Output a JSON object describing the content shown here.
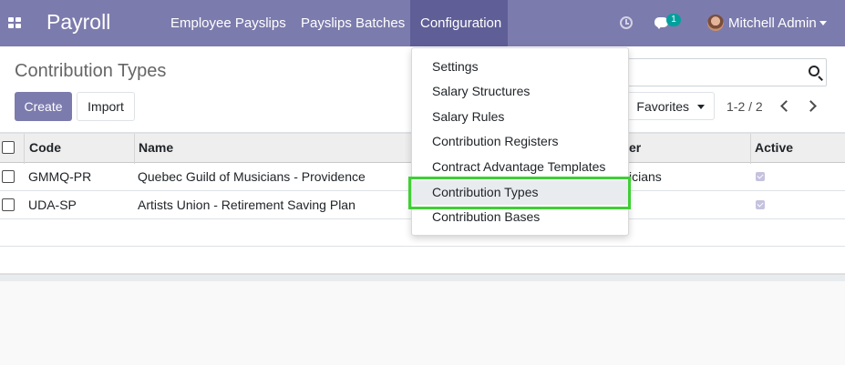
{
  "navbar": {
    "brand": "Payroll",
    "menu": [
      {
        "label": "Employee Payslips"
      },
      {
        "label": "Payslips Batches"
      },
      {
        "label": "Configuration"
      }
    ],
    "chat_count": "1",
    "user_name": "Mitchell Admin",
    "background_color": "#7c7bad"
  },
  "control_panel": {
    "title": "Contribution Types",
    "create_label": "Create",
    "import_label": "Import",
    "favorites_label": "Favorites",
    "pager": "1-2 / 2"
  },
  "table": {
    "columns": [
      "Code",
      "Name",
      "",
      "Active"
    ],
    "visible_partial_header": "er",
    "rows": [
      {
        "code": "GMMQ-PR",
        "name": "Quebec Guild of Musicians - Providence",
        "partial": "icians",
        "active": true
      },
      {
        "code": "UDA-SP",
        "name": "Artists Union - Retirement Saving Plan",
        "partial": "",
        "active": true
      }
    ]
  },
  "dropdown": {
    "items": [
      {
        "label": "Settings"
      },
      {
        "label": "Salary Structures"
      },
      {
        "label": "Salary Rules"
      },
      {
        "label": "Contribution Registers"
      },
      {
        "label": "Contract Advantage Templates"
      },
      {
        "label": "Contribution Types"
      },
      {
        "label": "Contribution Bases"
      }
    ],
    "highlighted": "Contribution Types"
  },
  "colors": {
    "primary": "#7c7bad",
    "primary_dark": "#5f5e97",
    "badge": "#00a09d",
    "highlight_outline": "#3fcf34"
  },
  "icons": [
    "apps-icon",
    "clock-icon",
    "chat-icon",
    "avatar",
    "caret-down-icon",
    "search-icon",
    "chevron-left-icon",
    "chevron-right-icon",
    "checkbox-icon"
  ]
}
